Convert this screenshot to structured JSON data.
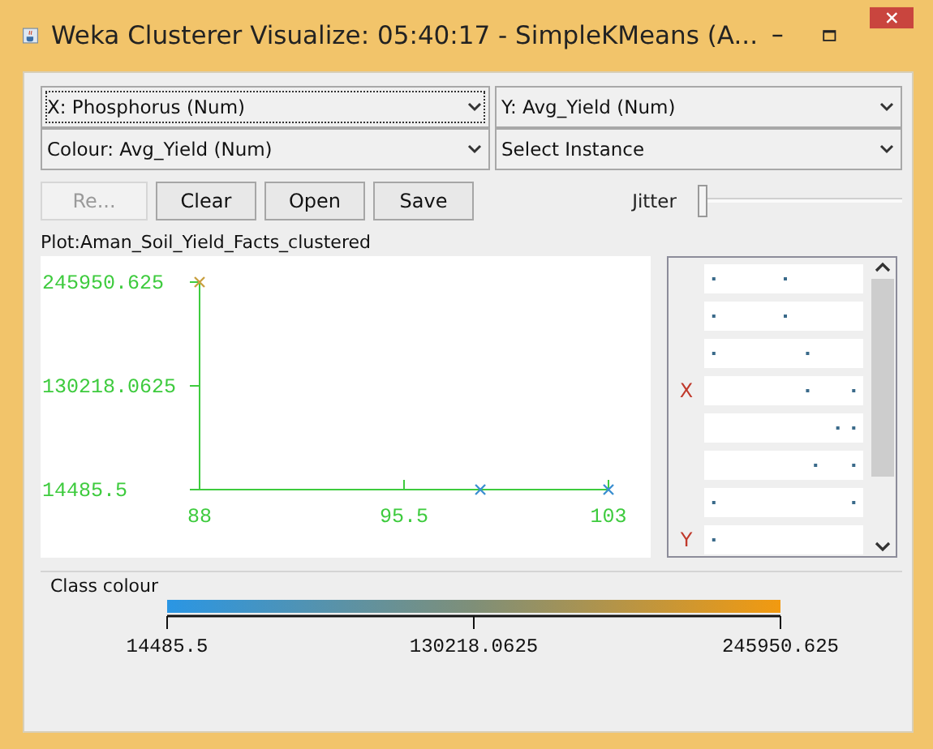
{
  "window": {
    "title": "Weka Clusterer Visualize: 05:40:17 - SimpleKMeans (A..."
  },
  "selectors": [
    {
      "value": "X: Phosphorus (Num)",
      "focused": true
    },
    {
      "value": "Y: Avg_Yield (Num)",
      "focused": false
    },
    {
      "value": "Colour: Avg_Yield (Num)",
      "focused": false
    },
    {
      "value": "Select Instance",
      "focused": false
    }
  ],
  "buttons": [
    {
      "label": "Re...",
      "disabled": true
    },
    {
      "label": "Clear",
      "disabled": false
    },
    {
      "label": "Open",
      "disabled": false
    },
    {
      "label": "Save",
      "disabled": false
    }
  ],
  "jitter": {
    "label": "Jitter",
    "level": 0
  },
  "plot": {
    "title": "Plot:Aman_Soil_Yield_Facts_clustered",
    "chart_data": {
      "type": "scatter",
      "x": [
        88,
        98.3,
        103
      ],
      "series": [
        {
          "color": "#c9a040",
          "values": [
            245950.625,
            null,
            null
          ]
        },
        {
          "color": "#3a8fd0",
          "values": [
            null,
            14485.5,
            14485.5
          ]
        }
      ],
      "xlim": [
        88,
        103
      ],
      "ylim": [
        14485.5,
        245950.625
      ],
      "xticks": [
        88,
        95.5,
        103
      ],
      "yticks": [
        14485.5,
        {
          "value": 130218.0625,
          "label": "130218.0625"
        },
        245950.625
      ]
    }
  },
  "strips": [
    {
      "kind": "plain"
    },
    {
      "kind": "plain"
    },
    {
      "kind": "plain"
    },
    {
      "kind": "labelled",
      "label": "X"
    },
    {
      "kind": "plain"
    },
    {
      "kind": "plain"
    },
    {
      "kind": "plain"
    },
    {
      "kind": "labelled",
      "label": "Y"
    }
  ],
  "class_colour": {
    "title": "Class colour",
    "ticks": [
      "14485.5",
      "130218.0625",
      "245950.625"
    ]
  }
}
